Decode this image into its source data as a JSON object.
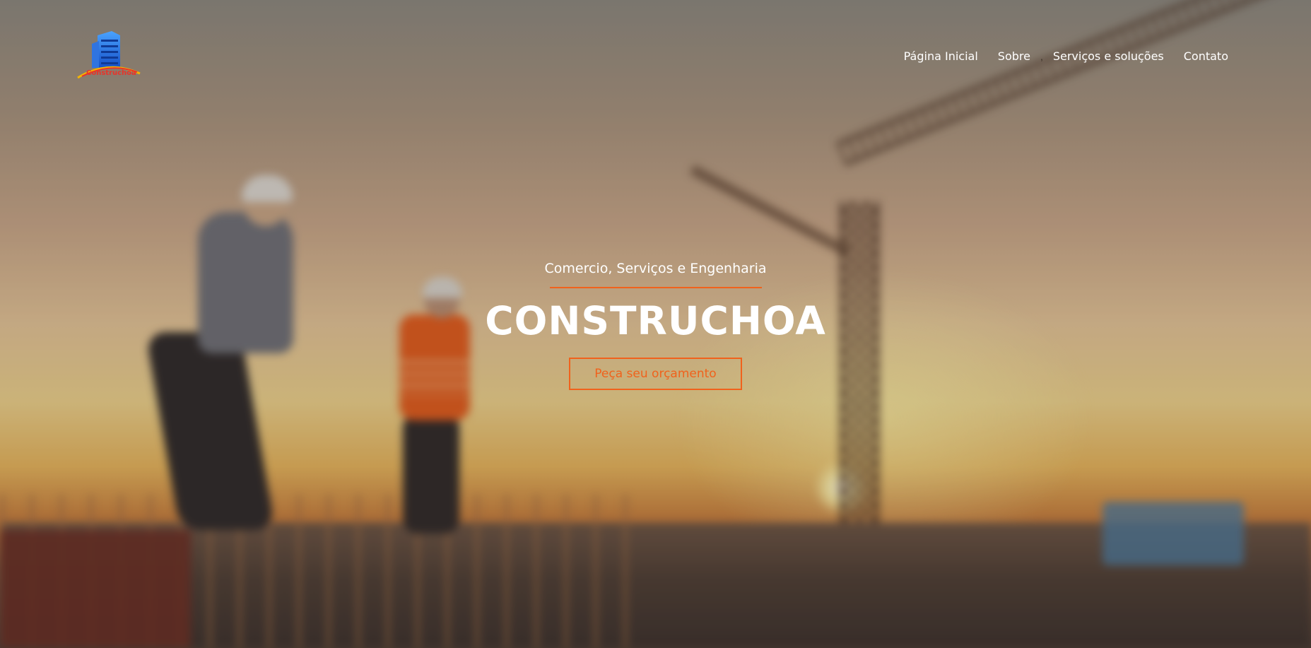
{
  "header": {
    "logo_icon": "building-logo-icon",
    "logo_text": "Construchoa"
  },
  "nav": {
    "items": [
      {
        "label": "Página Inicial"
      },
      {
        "label": "Sobre"
      },
      {
        "label": "Serviços e soluções"
      },
      {
        "label": "Contato"
      }
    ]
  },
  "hero": {
    "subtitle": "Comercio, Serviços e Engenharia",
    "title": "CONSTRUCHOA",
    "cta_label": "Peça seu orçamento"
  },
  "colors": {
    "accent": "#f0621c",
    "text": "#ffffff"
  }
}
